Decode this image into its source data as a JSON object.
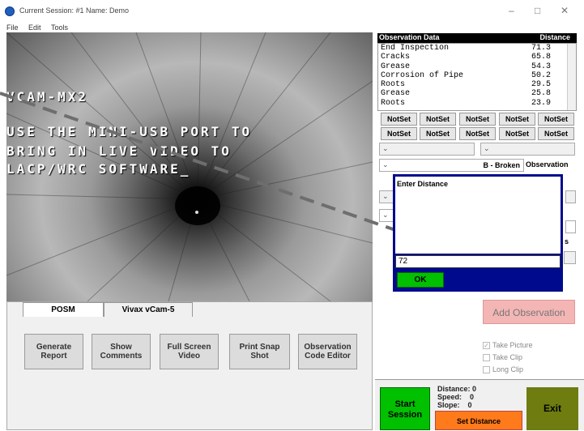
{
  "window": {
    "title": "Current Session: #1 Name: Demo",
    "minimize": "–",
    "maximize": "□",
    "close": "✕"
  },
  "menu": [
    "File",
    "Edit",
    "Tools"
  ],
  "video": {
    "line1": "VCAM-MX2",
    "line2": "USE THE MINI-USB PORT TO",
    "line3": "BRING IN LIVE VIDEO TO",
    "line4": "LACP/WRC SOFTWARE_"
  },
  "tabs": [
    "POSM",
    "Vivax vCam-5"
  ],
  "actions": [
    "Generate Report",
    "Show Comments",
    "Full Screen Video",
    "Print Snap Shot",
    "Observation Code Editor"
  ],
  "observations": {
    "header_left": "Observation Data",
    "header_right": "Distance",
    "rows": [
      {
        "name": "End Inspection",
        "distance": "71.3"
      },
      {
        "name": "Cracks",
        "distance": "65.8"
      },
      {
        "name": "Grease",
        "distance": "54.3"
      },
      {
        "name": "Corrosion of Pipe",
        "distance": "50.2"
      },
      {
        "name": "Roots",
        "distance": "29.5"
      },
      {
        "name": "Grease",
        "distance": "25.8"
      },
      {
        "name": "Roots",
        "distance": "23.9"
      }
    ]
  },
  "notset": [
    "NotSet",
    "NotSet",
    "NotSet",
    "NotSet",
    "NotSet",
    "NotSet",
    "NotSet",
    "NotSet",
    "NotSet",
    "NotSet"
  ],
  "observation_select": {
    "value": "B - Broken",
    "label": "Observation"
  },
  "dialog": {
    "title": "Enter Distance",
    "value": "72",
    "ok": "OK",
    "partial_s": "s"
  },
  "add_observation": "Add Observation",
  "options": [
    {
      "label": "Take Picture",
      "checked": true
    },
    {
      "label": "Take Clip",
      "checked": false
    },
    {
      "label": "Long Clip",
      "checked": false
    }
  ],
  "session": {
    "start": "Start Session",
    "distance": "Distance: 0",
    "speed": "Speed:    0",
    "slope": "Slope:    0",
    "set_distance": "Set Distance",
    "exit": "Exit"
  }
}
